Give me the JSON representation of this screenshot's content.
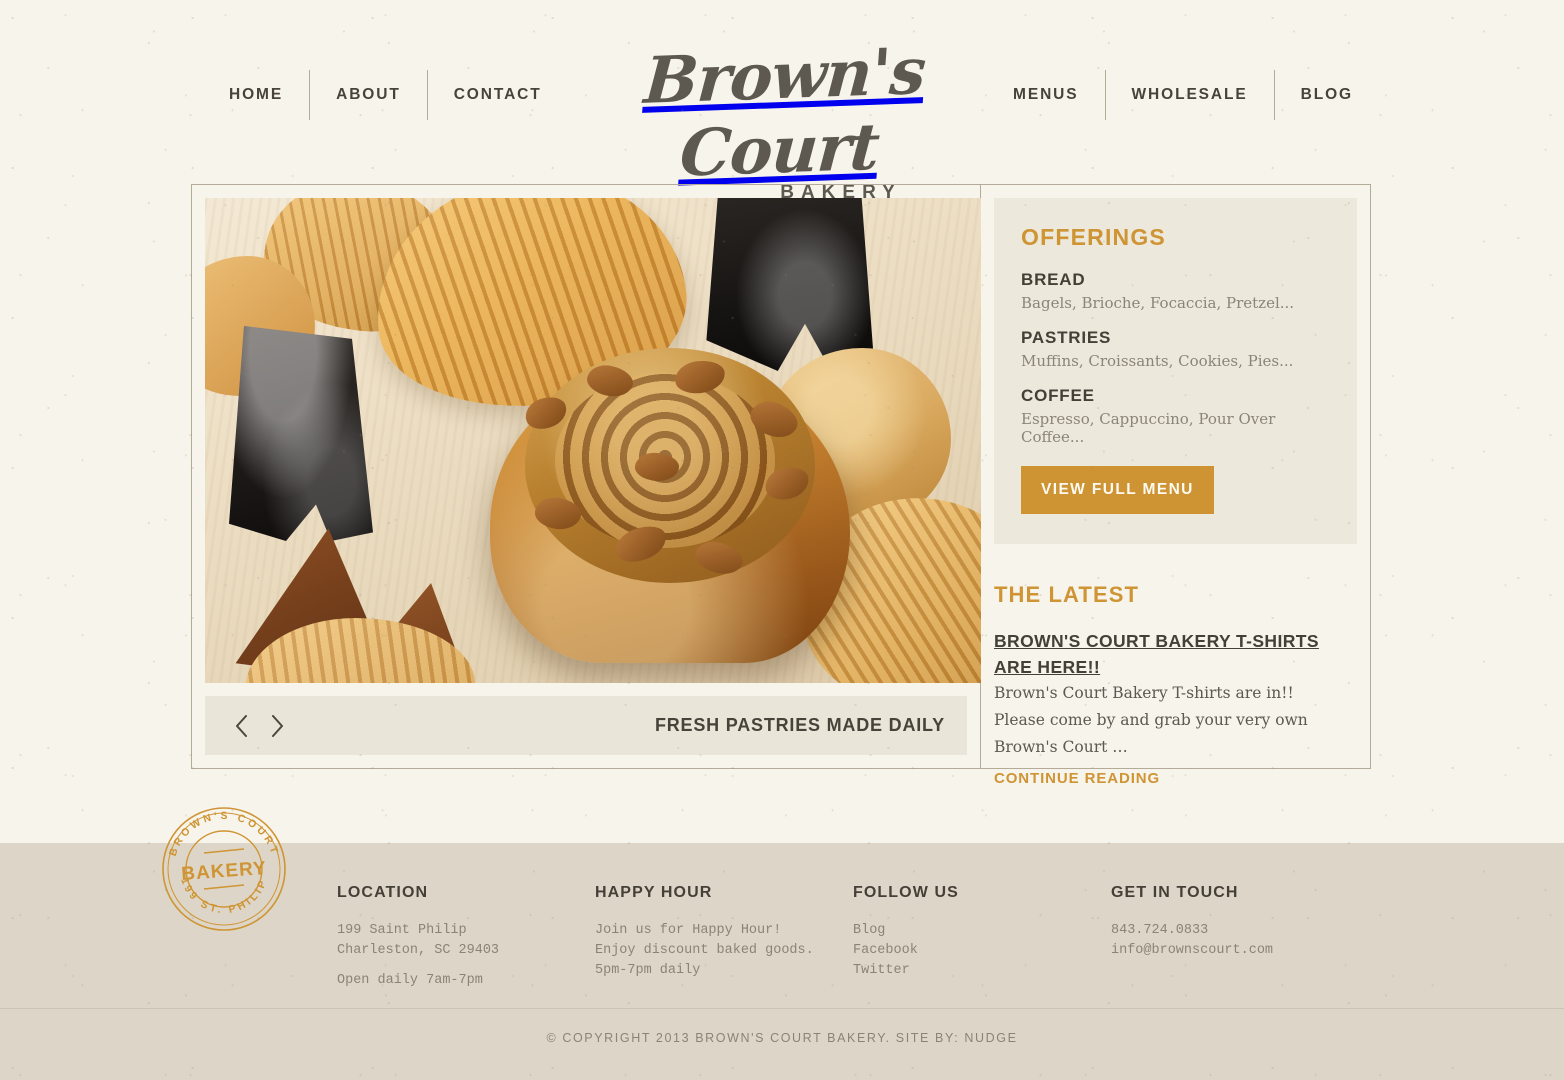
{
  "site": {
    "logo_script": "Brown's Court",
    "logo_sub": "BAKERY"
  },
  "nav": {
    "left": [
      {
        "label": "HOME"
      },
      {
        "label": "ABOUT"
      },
      {
        "label": "CONTACT"
      }
    ],
    "right": [
      {
        "label": "MENUS"
      },
      {
        "label": "WHOLESALE"
      },
      {
        "label": "BLOG"
      }
    ]
  },
  "slider": {
    "caption": "FRESH PASTRIES MADE DAILY",
    "prev_icon": "chevron-left-icon",
    "next_icon": "chevron-right-icon",
    "image_alt": "Sticky bun with pecans on a wooden board surrounded by pastries and dark cakes"
  },
  "offerings": {
    "title": "OFFERINGS",
    "items": [
      {
        "name": "BREAD",
        "desc": "Bagels, Brioche, Focaccia, Pretzel..."
      },
      {
        "name": "PASTRIES",
        "desc": "Muffins, Croissants, Cookies, Pies..."
      },
      {
        "name": "COFFEE",
        "desc": "Espresso, Cappuccino, Pour Over Coffee..."
      }
    ],
    "button_label": "VIEW FULL MENU"
  },
  "latest": {
    "title": "THE LATEST",
    "post_title": "BROWN'S COURT BAKERY T-SHIRTS ARE HERE!!",
    "post_excerpt": "Brown's Court Bakery T-shirts are in!! Please come by and grab your very own Brown's Court …",
    "continue_label": "CONTINUE READING"
  },
  "footer": {
    "stamp": {
      "top_arc": "BROWN'S COURT",
      "bottom_arc": "199 ST. PHILIP",
      "center": "BAKERY"
    },
    "location": {
      "heading": "LOCATION",
      "line1": "199 Saint Philip",
      "line2": "Charleston, SC 29403",
      "line3": "Open daily 7am-7pm"
    },
    "happy_hour": {
      "heading": "HAPPY HOUR",
      "line1": "Join us for Happy Hour!",
      "line2": "Enjoy discount baked goods.",
      "line3": "5pm-7pm daily"
    },
    "follow": {
      "heading": "FOLLOW US",
      "links": [
        {
          "label": "Blog"
        },
        {
          "label": "Facebook"
        },
        {
          "label": "Twitter"
        }
      ]
    },
    "touch": {
      "heading": "GET IN TOUCH",
      "phone": "843.724.0833",
      "email": "info@brownscourt.com"
    },
    "copyright": "© COPYRIGHT 2013 BROWN'S COURT BAKERY. SITE BY: NUDGE"
  },
  "colors": {
    "page_bg": "#f7f4ec",
    "accent_gold": "#ce9332",
    "text_dark": "#443f37",
    "text_muted": "#8b8476",
    "footer_bg": "#ddd6c8",
    "rule": "#b3ab97",
    "panel_bg": "#ece8dc"
  }
}
